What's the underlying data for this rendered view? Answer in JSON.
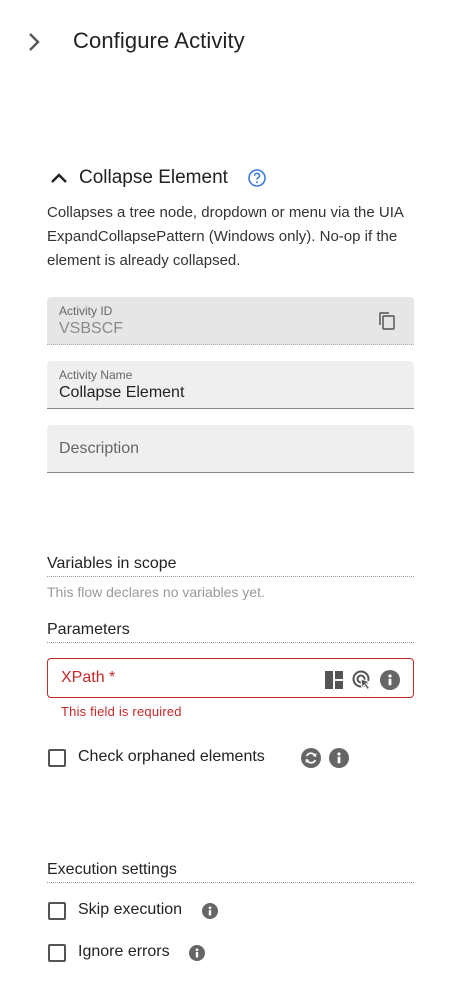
{
  "header": {
    "title": "Configure Activity",
    "expand_icon": "chevron-right-icon"
  },
  "section": {
    "title": "Collapse Element",
    "collapse_icon": "chevron-up-icon",
    "help_icon": "help-circle-icon",
    "description": "Collapses a tree node, dropdown or menu via the UIA ExpandCollapsePattern (Windows only). No-op if the element is already collapsed."
  },
  "fields": {
    "activity_id": {
      "label": "Activity ID",
      "value": "VSBSCF"
    },
    "activity_name": {
      "label": "Activity Name",
      "value": "Collapse Element"
    },
    "description": {
      "placeholder": "Description"
    }
  },
  "variables": {
    "heading": "Variables in scope",
    "empty_text": "This flow declares no variables yet."
  },
  "parameters": {
    "heading": "Parameters",
    "xpath": {
      "label": "XPath *",
      "error": "This field is required"
    },
    "check_orphaned": {
      "label": "Check orphaned elements",
      "checked": false
    }
  },
  "execution": {
    "heading": "Execution settings",
    "skip": {
      "label": "Skip execution",
      "checked": false
    },
    "ignore_errors": {
      "label": "Ignore errors",
      "checked": false
    }
  },
  "colors": {
    "error": "#c62828",
    "accent": "#3d7bd9",
    "field_bg": "#efefef"
  }
}
